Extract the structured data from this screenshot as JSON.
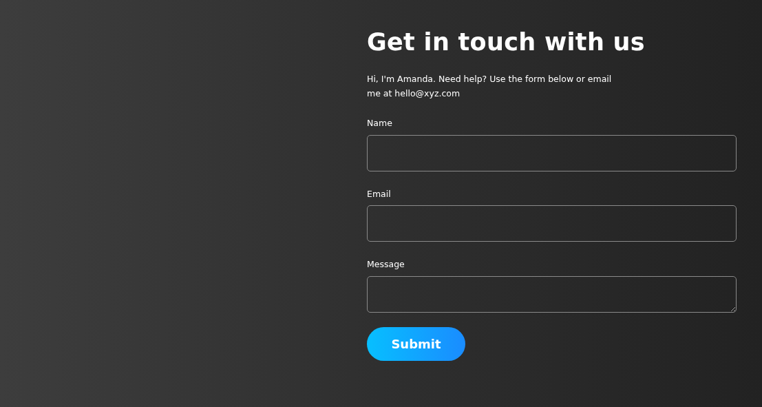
{
  "heading": "Get in touch with us",
  "intro": "Hi, I'm Amanda. Need help? Use the form below or email me at hello@xyz.com",
  "fields": [
    {
      "label": "Name",
      "kind": "input"
    },
    {
      "label": "Email",
      "kind": "input"
    },
    {
      "label": "Message",
      "kind": "textarea"
    }
  ],
  "submit": "Submit"
}
